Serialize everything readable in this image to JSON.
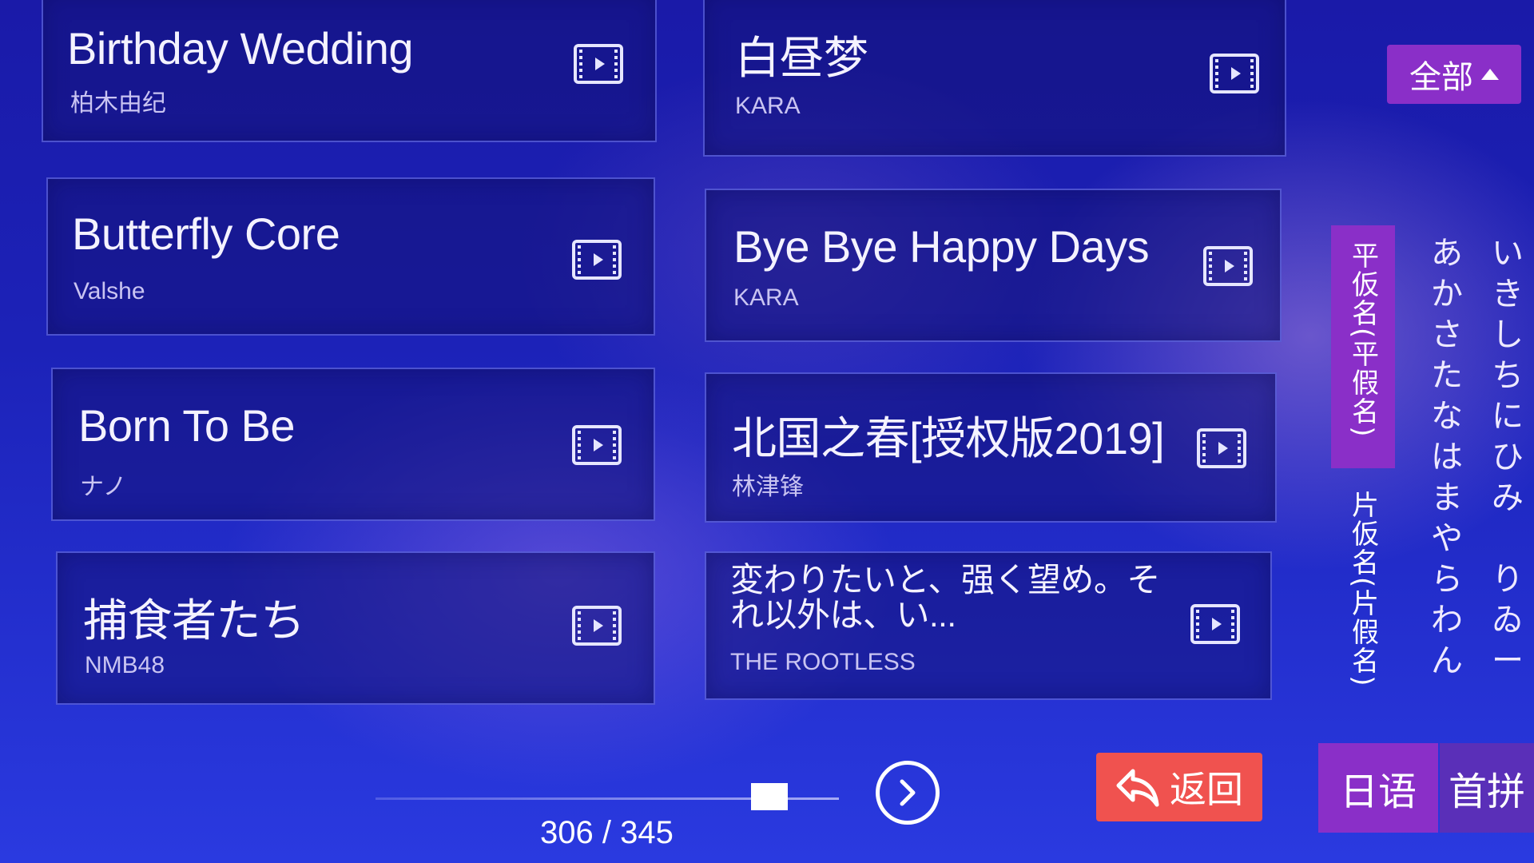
{
  "filter_button": {
    "label": "全部"
  },
  "songs": [
    {
      "title": "Birthday Wedding",
      "artist": "柏木由纪"
    },
    {
      "title": "白昼梦",
      "artist": "KARA"
    },
    {
      "title": "Butterfly Core",
      "artist": "Valshe"
    },
    {
      "title": "Bye Bye Happy Days",
      "artist": "KARA"
    },
    {
      "title": "Born To Be",
      "artist": "ナノ"
    },
    {
      "title": "北国之春[授权版2019]",
      "artist": "林津锋"
    },
    {
      "title": "捕食者たち",
      "artist": "NMB48"
    },
    {
      "title": "変わりたいと、强く望め。それ以外は、い...",
      "artist": "THE ROOTLESS"
    }
  ],
  "side_tabs": {
    "hiragana": "平仮名(平假名)",
    "katakana": "片仮名(片假名)"
  },
  "kana_index": {
    "col1": [
      "あ",
      "か",
      "さ",
      "た",
      "な",
      "は",
      "ま",
      "や",
      "ら",
      "わ",
      "ん"
    ],
    "col2": [
      "い",
      "き",
      "し",
      "ち",
      "に",
      "ひ",
      "み",
      "",
      "り",
      "ゐ",
      "ー"
    ]
  },
  "bottom_tabs": {
    "japanese": "日语",
    "initials": "首拼"
  },
  "back_button": {
    "label": "返回"
  },
  "pager": {
    "current": "306",
    "total": "345",
    "text": "306 / 345",
    "position_fraction": 0.887
  },
  "colors": {
    "accent_purple": "#8a2fc8",
    "back_red": "#f0524f",
    "background": "#1c22b8"
  }
}
